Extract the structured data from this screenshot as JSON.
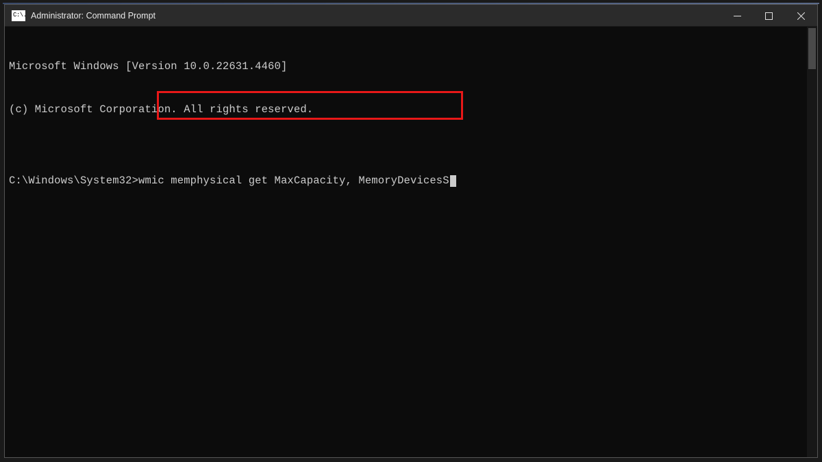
{
  "titlebar": {
    "icon_text": "C:\\.",
    "title": "Administrator: Command Prompt"
  },
  "terminal": {
    "line1": "Microsoft Windows [Version 10.0.22631.4460]",
    "line2": "(c) Microsoft Corporation. All rights reserved.",
    "blank": "",
    "prompt": "C:\\Windows\\System32>",
    "command_prefix": "wmic ",
    "command_highlighted": "memphysical get MaxCapacity, MemoryDevicesS"
  }
}
